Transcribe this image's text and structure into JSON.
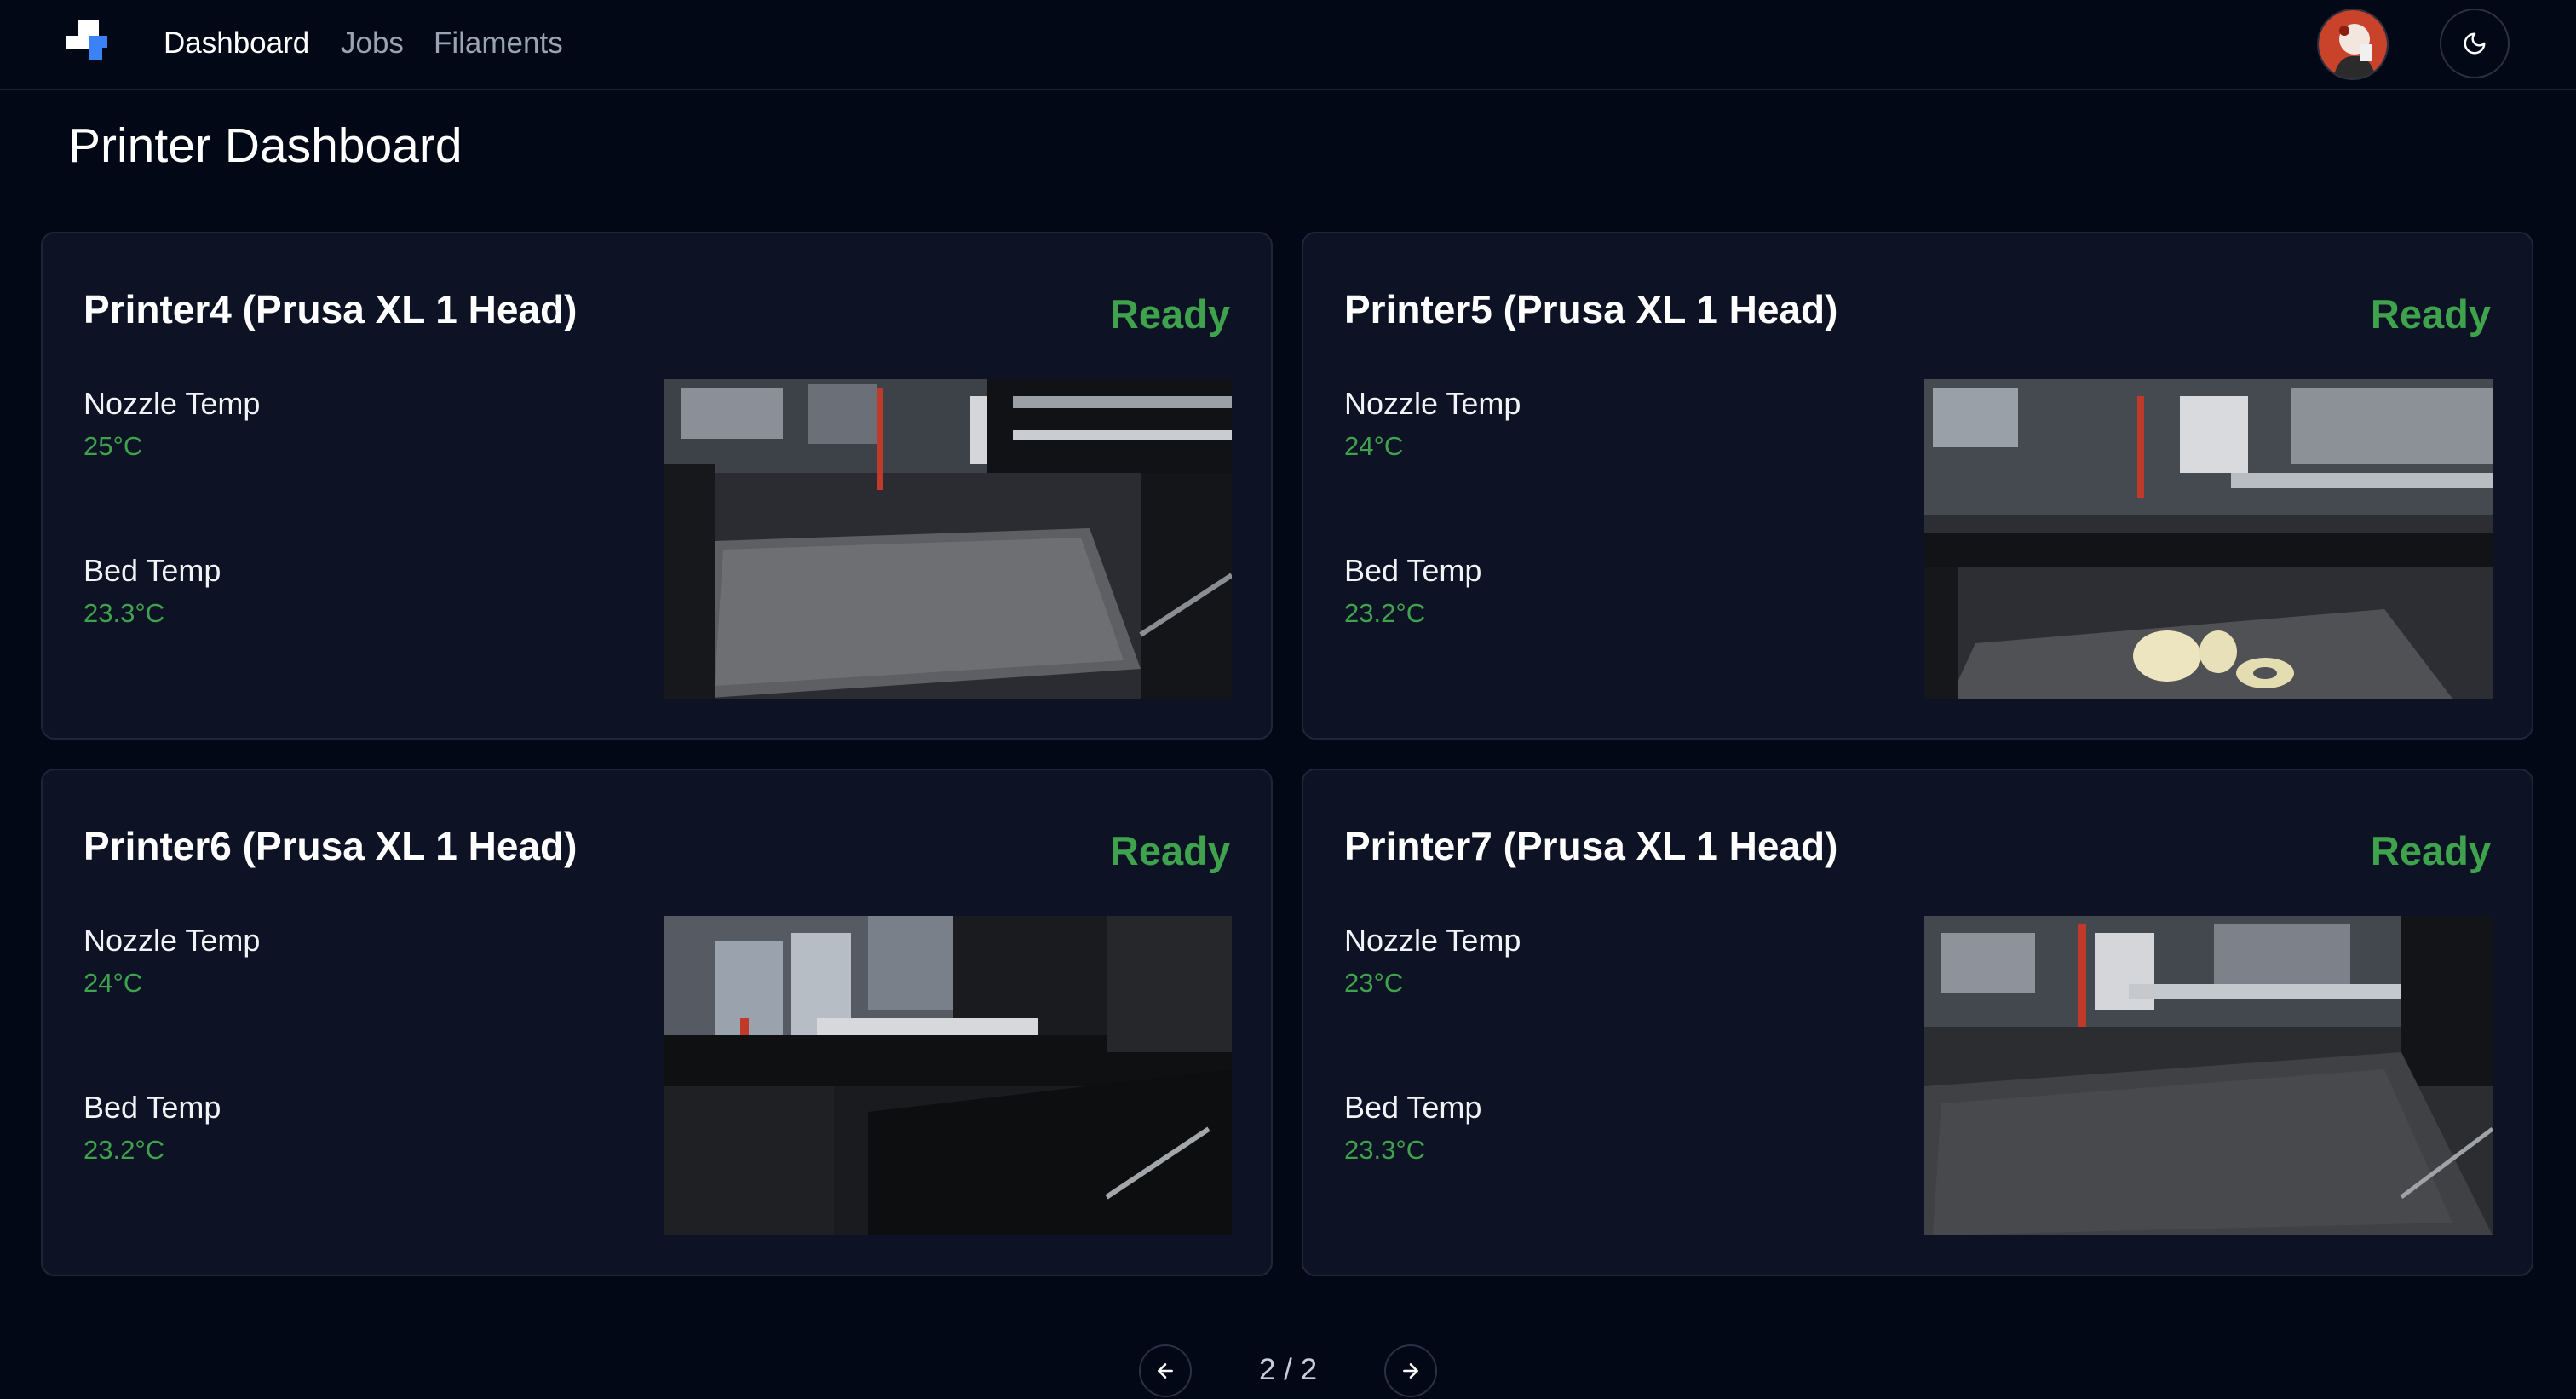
{
  "nav": {
    "links": [
      "Dashboard",
      "Jobs",
      "Filaments"
    ],
    "active": "Dashboard"
  },
  "page": {
    "title": "Printer Dashboard"
  },
  "printers": [
    {
      "name": "Printer4 (Prusa XL 1 Head)",
      "status": "Ready",
      "nozzle_label": "Nozzle Temp",
      "nozzle_temp": "25°C",
      "bed_label": "Bed Temp",
      "bed_temp": "23.3°C"
    },
    {
      "name": "Printer5 (Prusa XL 1 Head)",
      "status": "Ready",
      "nozzle_label": "Nozzle Temp",
      "nozzle_temp": "24°C",
      "bed_label": "Bed Temp",
      "bed_temp": "23.2°C"
    },
    {
      "name": "Printer6 (Prusa XL 1 Head)",
      "status": "Ready",
      "nozzle_label": "Nozzle Temp",
      "nozzle_temp": "24°C",
      "bed_label": "Bed Temp",
      "bed_temp": "23.2°C"
    },
    {
      "name": "Printer7 (Prusa XL 1 Head)",
      "status": "Ready",
      "nozzle_label": "Nozzle Temp",
      "nozzle_temp": "23°C",
      "bed_label": "Bed Temp",
      "bed_temp": "23.3°C"
    }
  ],
  "pagination": {
    "text": "2 / 2"
  },
  "icons": {
    "theme": "moon-icon",
    "prev": "arrow-left-icon",
    "next": "arrow-right-icon",
    "logo": "app-logo-icon"
  },
  "colors": {
    "background": "#030817",
    "card": "#0d1324",
    "status_ready": "#3fa34d",
    "accent": "#3b82f6"
  }
}
